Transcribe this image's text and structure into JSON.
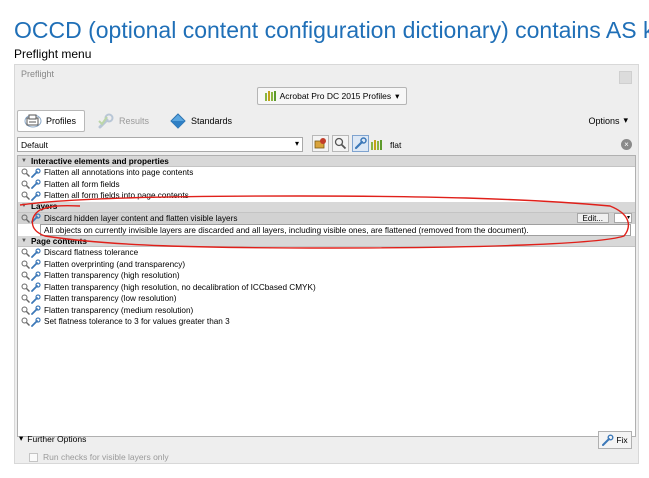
{
  "doc": {
    "title": "OCCD (optional content configuration dictionary) contains AS key",
    "subtitle": "Preflight menu"
  },
  "window": {
    "title": "Preflight",
    "profile_dropdown": "Acrobat Pro DC 2015 Profiles"
  },
  "tabs": [
    {
      "label": "Profiles",
      "state": "active"
    },
    {
      "label": "Results",
      "state": "disabled"
    },
    {
      "label": "Standards",
      "state": "normal"
    }
  ],
  "options_label": "Options",
  "filter": {
    "selected": "Default",
    "search_value": "flat"
  },
  "groups": [
    {
      "name": "Interactive elements and properties",
      "items": [
        "Flatten all annotations into page contents",
        "Flatten all form fields",
        "Flatten all form fields into page contents"
      ]
    },
    {
      "name": "Layers",
      "items": [
        "Discard hidden layer content and flatten visible layers"
      ],
      "selected_description": "All objects on currently invisible layers are discarded and all layers, including visible ones, are flattened (removed from the document).",
      "edit_label": "Edit..."
    },
    {
      "name": "Page contents",
      "items": [
        "Discard flatness tolerance",
        "Flatten overprinting (and transparency)",
        "Flatten transparency (high resolution)",
        "Flatten transparency (high resolution, no decalibration of ICCbased CMYK)",
        "Flatten transparency (low resolution)",
        "Flatten transparency (medium resolution)",
        "Set flatness tolerance to 3 for values greater than 3"
      ]
    }
  ],
  "footer": {
    "further_options": "Further Options",
    "fix_label": "Fix",
    "run_checks": "Run checks for visible layers only"
  },
  "colors": {
    "title_blue": "#1f6fb7",
    "annotation_red": "#e0201a"
  }
}
